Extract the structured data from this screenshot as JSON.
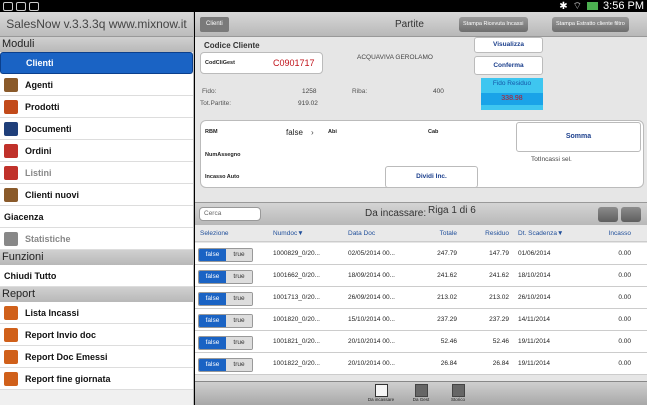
{
  "statusbar": {
    "time": "3:56 PM"
  },
  "sidebar": {
    "title": "SalesNow v.3.3.3q www.mixnow.it",
    "sections": {
      "moduli": "Moduli",
      "funzioni": "Funzioni",
      "report": "Report"
    },
    "moduli_items": [
      {
        "label": "Clienti",
        "selected": true
      },
      {
        "label": "Agenti"
      },
      {
        "label": "Prodotti"
      },
      {
        "label": "Documenti"
      },
      {
        "label": "Ordini"
      },
      {
        "label": "Listini",
        "disabled": true
      },
      {
        "label": "Clienti nuovi"
      },
      {
        "label": "Giacenza"
      },
      {
        "label": "Statistiche",
        "disabled": true
      }
    ],
    "funzioni_items": [
      {
        "label": "Chiudi Tutto"
      }
    ],
    "report_items": [
      {
        "label": "Lista Incassi"
      },
      {
        "label": "Report Invio doc"
      },
      {
        "label": "Report Doc Emessi"
      },
      {
        "label": "Report fine giornata"
      }
    ]
  },
  "header": {
    "back": "Clienti",
    "title": "Partite",
    "btn_ricevuta": "Stampa Ricevuta Incassi",
    "btn_estratto": "Stampa Estratto cliente filtro"
  },
  "cliente": {
    "section_label": "Codice Cliente",
    "code_label": "CodCliGest",
    "code_value": "C0901717",
    "name": "ACQUAVIVA GEROLAMO",
    "btn_visualizza": "Visualizza",
    "btn_conferma": "Conferma",
    "fido_label": "Fido:",
    "fido_value": "1258",
    "riba_label": "Riba:",
    "riba_value": "400",
    "tot_label": "Tot.Partite:",
    "tot_value": "919.02",
    "fido_residuo_label": "Fido Residuo",
    "fido_residuo_value": "338.98"
  },
  "incasso": {
    "rbm_label": "RBM",
    "rbm_value": "false",
    "abi_label": "Abi",
    "cab_label": "Cab",
    "numassegno_label": "NumAssegno",
    "incasso_auto_label": "Incasso Auto",
    "btn_dividi": "Dividi Inc.",
    "btn_somma": "Somma",
    "tot_incassi_label": "TotIncassi sel."
  },
  "list": {
    "search_placeholder": "Cerca",
    "title": "Da incassare:",
    "counter": "Riga 1 di 6",
    "columns": [
      "Selezione",
      "Numdoc▼",
      "Data Doc",
      "Totale",
      "Residuo",
      "Dt. Scadenza▼",
      "Incasso"
    ],
    "toggle_false": "false",
    "toggle_true": "true",
    "rows": [
      {
        "numdoc": "1000829_0/20...",
        "data": "02/05/2014 00...",
        "totale": "247.79",
        "residuo": "147.79",
        "scad": "01/06/2014",
        "incasso": "0.00"
      },
      {
        "numdoc": "1001662_0/20...",
        "data": "18/09/2014 00...",
        "totale": "241.62",
        "residuo": "241.62",
        "scad": "18/10/2014",
        "incasso": "0.00"
      },
      {
        "numdoc": "1001713_0/20...",
        "data": "26/09/2014 00...",
        "totale": "213.02",
        "residuo": "213.02",
        "scad": "26/10/2014",
        "incasso": "0.00"
      },
      {
        "numdoc": "1001820_0/20...",
        "data": "15/10/2014 00...",
        "totale": "237.29",
        "residuo": "237.29",
        "scad": "14/11/2014",
        "incasso": "0.00"
      },
      {
        "numdoc": "1001821_0/20...",
        "data": "20/10/2014 00...",
        "totale": "52.46",
        "residuo": "52.46",
        "scad": "19/11/2014",
        "incasso": "0.00"
      },
      {
        "numdoc": "1001822_0/20...",
        "data": "20/10/2014 00...",
        "totale": "26.84",
        "residuo": "26.84",
        "scad": "19/11/2014",
        "incasso": "0.00"
      }
    ]
  },
  "bottom_nav": [
    {
      "label": "Da incassare",
      "active": true
    },
    {
      "label": "Da Gest"
    },
    {
      "label": "Storico"
    }
  ],
  "colors": {
    "accent": "#1a63c4",
    "fido_residuo_bg": "#3ec6f0",
    "fido_residuo_value_bg": "#1aa3e8"
  }
}
